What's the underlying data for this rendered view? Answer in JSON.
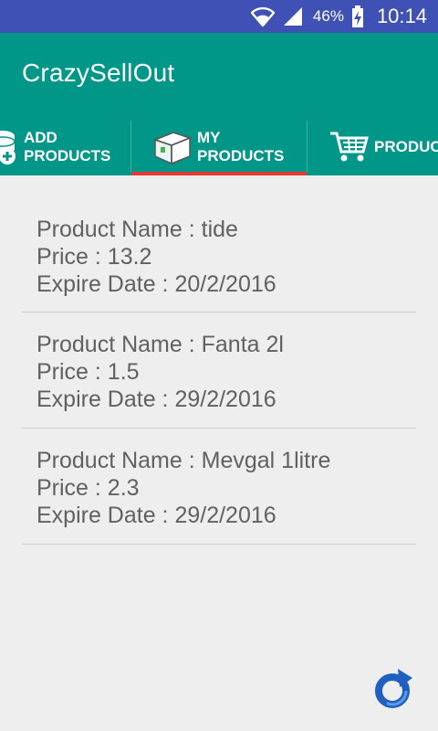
{
  "status_bar": {
    "battery_percent": "46%",
    "time": "10:14",
    "icons": [
      "wifi-icon",
      "signal-icon",
      "battery-charging-icon"
    ],
    "background": "#3f51b5"
  },
  "app": {
    "title": "CrazySellOut",
    "primary_color": "#009688",
    "indicator_color": "#e53935"
  },
  "tabs": [
    {
      "line1": "ADD",
      "line2": "PRODUCTS",
      "icon": "add-database-icon",
      "selected": false
    },
    {
      "line1": "MY",
      "line2": "PRODUCTS",
      "icon": "box-icon",
      "selected": true
    },
    {
      "line1": "PRODUCTS",
      "line2": "",
      "icon": "shopping-cart-icon",
      "selected": false
    }
  ],
  "products": [
    {
      "name": "Product Name : tide",
      "price": "Price : 13.2",
      "expire": "Expire Date : 20/2/2016"
    },
    {
      "name": "Product Name : Fanta 2l",
      "price": "Price : 1.5",
      "expire": "Expire Date : 29/2/2016"
    },
    {
      "name": "Product Name : Mevgal 1litre",
      "price": "Price : 2.3",
      "expire": "Expire Date : 29/2/2016"
    }
  ],
  "refresh_button": {
    "icon": "refresh-icon",
    "color": "#1e5fbf"
  }
}
